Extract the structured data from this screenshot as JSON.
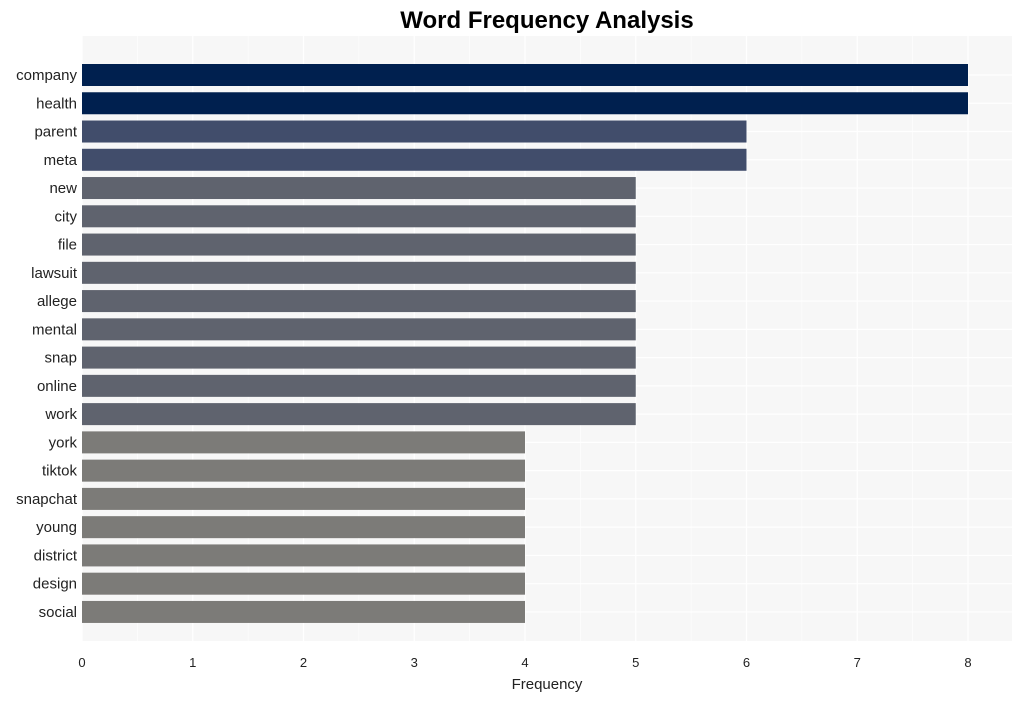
{
  "chart_data": {
    "type": "bar",
    "orientation": "horizontal",
    "title": "Word Frequency Analysis",
    "xlabel": "Frequency",
    "ylabel": "",
    "xlim": [
      0,
      8.4
    ],
    "xticks": [
      0,
      1,
      2,
      3,
      4,
      5,
      6,
      7,
      8
    ],
    "grid": true,
    "categories": [
      "company",
      "health",
      "parent",
      "meta",
      "new",
      "city",
      "file",
      "lawsuit",
      "allege",
      "mental",
      "snap",
      "online",
      "work",
      "york",
      "tiktok",
      "snapchat",
      "young",
      "district",
      "design",
      "social"
    ],
    "values": [
      8,
      8,
      6,
      6,
      5,
      5,
      5,
      5,
      5,
      5,
      5,
      5,
      5,
      4,
      4,
      4,
      4,
      4,
      4,
      4
    ],
    "colors_by_value": {
      "8": "#00204f",
      "6": "#414d6b",
      "5": "#5f636e",
      "4": "#7c7b78"
    },
    "background": "#f7f7f7",
    "gridline_color": "#ffffff"
  }
}
